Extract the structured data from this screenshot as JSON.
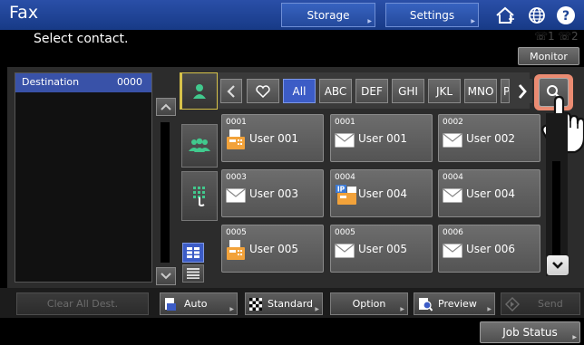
{
  "header": {
    "title": "Fax",
    "storage_label": "Storage",
    "settings_label": "Settings",
    "home_icon": "home-icon",
    "globe_icon": "globe-icon",
    "help_icon": "help-icon"
  },
  "message": "Select contact.",
  "line_indicators": [
    "1",
    "2"
  ],
  "monitor_label": "Monitor",
  "destination": {
    "label": "Destination",
    "count": "0000"
  },
  "filters": [
    "All",
    "ABC",
    "DEF",
    "GHI",
    "JKL",
    "MNO",
    "P"
  ],
  "contacts": [
    {
      "number": "0001",
      "name": "User 001",
      "type": "fax"
    },
    {
      "number": "0001",
      "name": "User 001",
      "type": "email"
    },
    {
      "number": "0002",
      "name": "User 002",
      "type": "email"
    },
    {
      "number": "0003",
      "name": "User 003",
      "type": "email"
    },
    {
      "number": "0004",
      "name": "User 004",
      "type": "ipfax"
    },
    {
      "number": "0004",
      "name": "User 004",
      "type": "email"
    },
    {
      "number": "0005",
      "name": "User 005",
      "type": "fax"
    },
    {
      "number": "0005",
      "name": "User 005",
      "type": "email"
    },
    {
      "number": "0006",
      "name": "User 006",
      "type": "email"
    }
  ],
  "bottom": {
    "clear_all": "Clear All Dest.",
    "auto": "Auto",
    "standard": "Standard",
    "option": "Option",
    "preview": "Preview",
    "send": "Send",
    "job_status": "Job Status"
  },
  "colors": {
    "header_blue": "#1f4596",
    "accent_blue": "#3952a8",
    "highlight": "#ea8b72",
    "active_tab": "#3c5cc6"
  }
}
